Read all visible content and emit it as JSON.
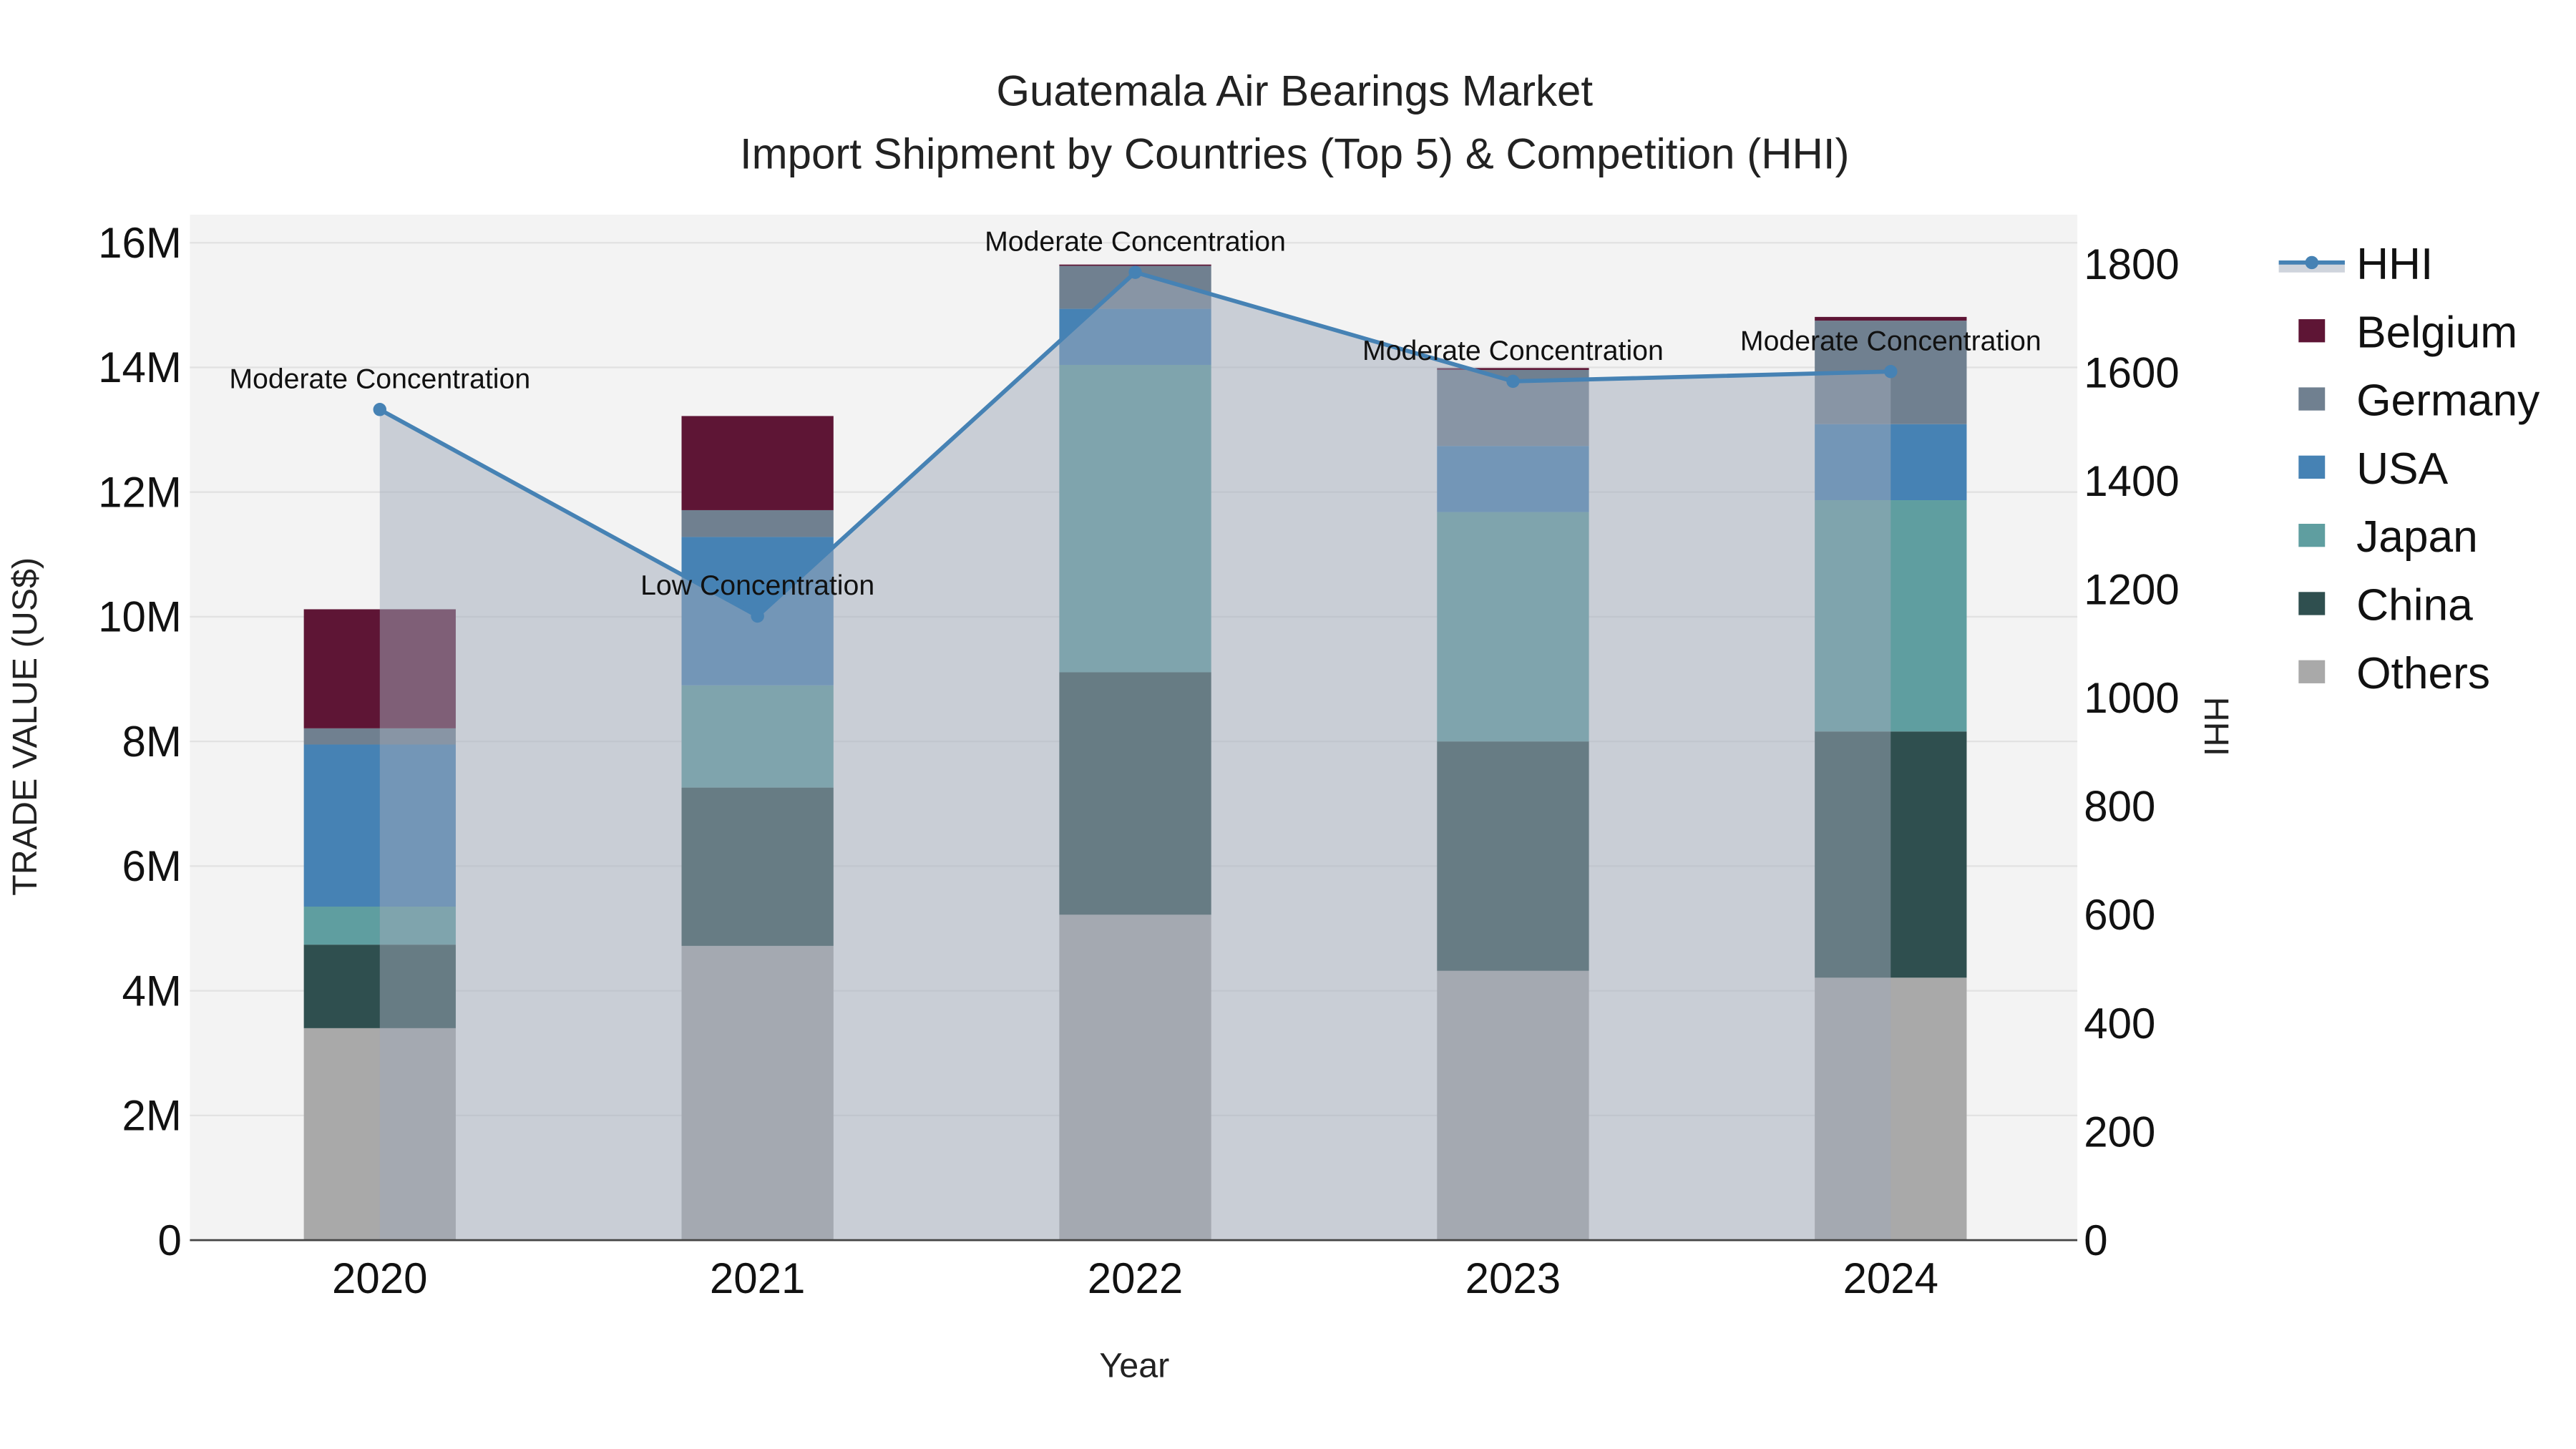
{
  "chart_data": {
    "type": "bar",
    "title": "Guatemala Air Bearings Market",
    "subtitle": "Import Shipment by Countries (Top 5) & Competition (HHI)",
    "xlabel": "Year",
    "ylabel": "TRADE VALUE (US$)",
    "y2label": "HHI",
    "categories": [
      "2020",
      "2021",
      "2022",
      "2023",
      "2024"
    ],
    "ylim": [
      0,
      16400000
    ],
    "y2lim": [
      0,
      1890
    ],
    "yticks": [
      {
        "v": 0,
        "label": "0"
      },
      {
        "v": 2000000,
        "label": "2M"
      },
      {
        "v": 4000000,
        "label": "4M"
      },
      {
        "v": 6000000,
        "label": "6M"
      },
      {
        "v": 8000000,
        "label": "8M"
      },
      {
        "v": 10000000,
        "label": "10M"
      },
      {
        "v": 12000000,
        "label": "12M"
      },
      {
        "v": 14000000,
        "label": "14M"
      },
      {
        "v": 16000000,
        "label": "16M"
      }
    ],
    "y2ticks": [
      {
        "v": 0,
        "label": "0"
      },
      {
        "v": 200,
        "label": "200"
      },
      {
        "v": 400,
        "label": "400"
      },
      {
        "v": 600,
        "label": "600"
      },
      {
        "v": 800,
        "label": "800"
      },
      {
        "v": 1000,
        "label": "1000"
      },
      {
        "v": 1200,
        "label": "1200"
      },
      {
        "v": 1400,
        "label": "1400"
      },
      {
        "v": 1600,
        "label": "1600"
      },
      {
        "v": 1800,
        "label": "1800"
      }
    ],
    "stack_order": [
      "Others",
      "China",
      "Japan",
      "USA",
      "Germany",
      "Belgium"
    ],
    "series": [
      {
        "name": "Others",
        "color": "#a9a9a9",
        "values": [
          3400000,
          4720000,
          5220000,
          4320000,
          4210000
        ]
      },
      {
        "name": "China",
        "color": "#2f4f4f",
        "values": [
          1340000,
          2540000,
          3890000,
          3680000,
          3950000
        ]
      },
      {
        "name": "Japan",
        "color": "#5f9ea0",
        "values": [
          610000,
          1640000,
          4930000,
          3680000,
          3710000
        ]
      },
      {
        "name": "USA",
        "color": "#4682b4",
        "values": [
          2600000,
          2380000,
          900000,
          1060000,
          1220000
        ]
      },
      {
        "name": "Germany",
        "color": "#708090",
        "values": [
          260000,
          430000,
          690000,
          1220000,
          1660000
        ]
      },
      {
        "name": "Belgium",
        "color": "#5e1535",
        "values": [
          1910000,
          1510000,
          20000,
          30000,
          60000
        ]
      }
    ],
    "hhi": {
      "name": "HHI",
      "color": "#4682b4",
      "values": [
        1532,
        1151,
        1785,
        1584,
        1602
      ],
      "annotations": [
        "Moderate Concentration",
        "Low Concentration",
        "Moderate Concentration",
        "Moderate Concentration",
        "Moderate Concentration"
      ]
    },
    "legend_order": [
      "HHI",
      "Belgium",
      "Germany",
      "USA",
      "Japan",
      "China",
      "Others"
    ],
    "legend_position": "right",
    "grid": true
  }
}
